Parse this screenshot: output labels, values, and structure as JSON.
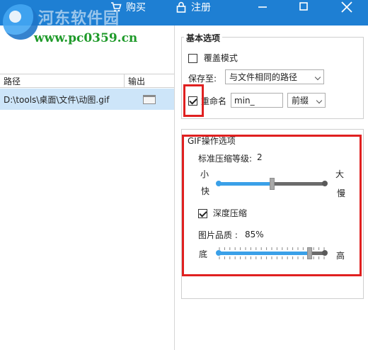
{
  "titlebar": {
    "buy_label": "购买",
    "register_label": "注册",
    "bg_color": "#1e7fd3"
  },
  "watermark": {
    "site_name": "河东软件园",
    "url": "www.pc0359.cn"
  },
  "file_list": {
    "columns": [
      "路径",
      "输出"
    ],
    "rows": [
      {
        "path": "D:\\tools\\桌面\\文件\\动图.gif",
        "output_icon": "folder-icon"
      }
    ]
  },
  "basic_options": {
    "title": "基本选项",
    "overwrite_label": "覆盖模式",
    "overwrite_checked": false,
    "save_to_label": "保存至:",
    "save_to_value": "与文件相同的路径",
    "rename_label": "重命名",
    "rename_checked": true,
    "rename_value": "min_",
    "affix_value": "前缀"
  },
  "gif_options": {
    "title": "GIF操作选项",
    "compression_level_label": "标准压缩等级:",
    "compression_level_value": "2",
    "small_label": "小",
    "large_label": "大",
    "fast_label": "快",
    "slow_label": "慢",
    "compression_level_fraction": 0.5,
    "deep_compress_label": "深度压缩",
    "deep_compress_checked": true,
    "quality_label": "图片品质 :",
    "quality_value": "85%",
    "low_label": "底",
    "high_label": "高",
    "quality_fraction": 0.85
  },
  "colors": {
    "accent": "#3aa0e8",
    "highlight_box": "#e02020",
    "selected_row": "#cde5f9"
  }
}
